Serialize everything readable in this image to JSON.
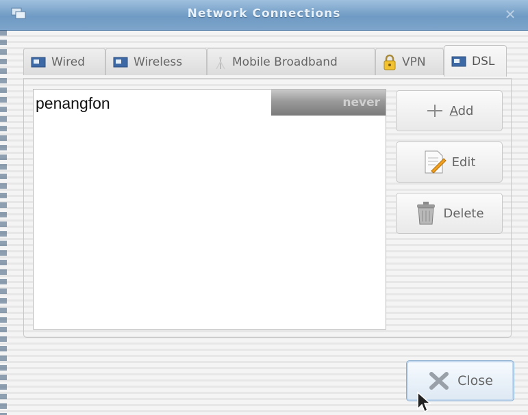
{
  "window": {
    "title": "Network Connections",
    "close_symbol": "✕",
    "icon": "network-icon"
  },
  "tabs": [
    {
      "label": "Wired",
      "icon": "wired-network-icon",
      "active": false
    },
    {
      "label": "Wireless",
      "icon": "wireless-network-icon",
      "active": false
    },
    {
      "label": "Mobile Broadband",
      "icon": "antenna-icon",
      "active": false
    },
    {
      "label": "VPN",
      "icon": "padlock-icon",
      "active": false
    },
    {
      "label": "DSL",
      "icon": "dsl-network-icon",
      "active": true
    }
  ],
  "connections": [
    {
      "name": "penangfon",
      "last_used": "never",
      "selected": true
    }
  ],
  "buttons": {
    "add": {
      "label": "Add",
      "mnemonic": "A",
      "rest": "dd",
      "icon": "add-icon"
    },
    "edit": {
      "label": "Edit",
      "icon": "edit-icon"
    },
    "delete": {
      "label": "Delete",
      "icon": "trash-icon"
    },
    "close": {
      "label": "Close",
      "mnemonic": "C",
      "rest": "lose",
      "icon": "close-x-icon"
    }
  },
  "colors": {
    "titlebar": "#7ea5cb",
    "title_text": "#e9f1f8",
    "selection_dark": "#7a7a7a"
  }
}
